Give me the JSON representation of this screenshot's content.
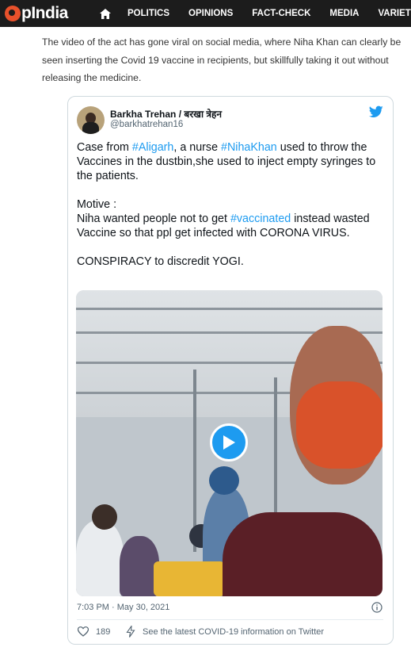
{
  "site": {
    "logo_text": "pIndia",
    "nav": {
      "home": "home-icon",
      "items": [
        "POLITICS",
        "OPINIONS",
        "FACT-CHECK",
        "MEDIA",
        "VARIETY"
      ]
    },
    "colors": {
      "topbar": "#1c1c1c",
      "logo_accent": "#e8512b"
    }
  },
  "article": {
    "paragraph": "The video of the act has gone viral on social media, where Niha Khan can clearly be seen inserting the Covid 19 vaccine in recipients, but skillfully taking it out without releasing the medicine."
  },
  "tweet": {
    "author_name": "Barkha Trehan / बरखा त्रेहन",
    "author_handle": "@barkhatrehan16",
    "line1_pre": "Case from ",
    "line1_tag1": "#Aligarh",
    "line1_mid": ", a nurse ",
    "line1_tag2": "#NihaKhan",
    "line1_post": " used to throw the Vaccines in the dustbin,she used to inject empty syringes to the patients.",
    "motive_label": "Motive :",
    "motive_pre": "Niha wanted people not to get ",
    "motive_tag": "#vaccinated",
    "motive_post": " instead wasted Vaccine so that ppl get infected with CORONA VIRUS.",
    "conspiracy": "CONSPIRACY to discredit YOGI.",
    "timestamp": "7:03 PM · May 30, 2021",
    "likes": "189",
    "covid_link": "See the latest COVID-19 information on Twitter",
    "colors": {
      "link": "#1d9bf0",
      "border": "#cfd9de"
    }
  }
}
